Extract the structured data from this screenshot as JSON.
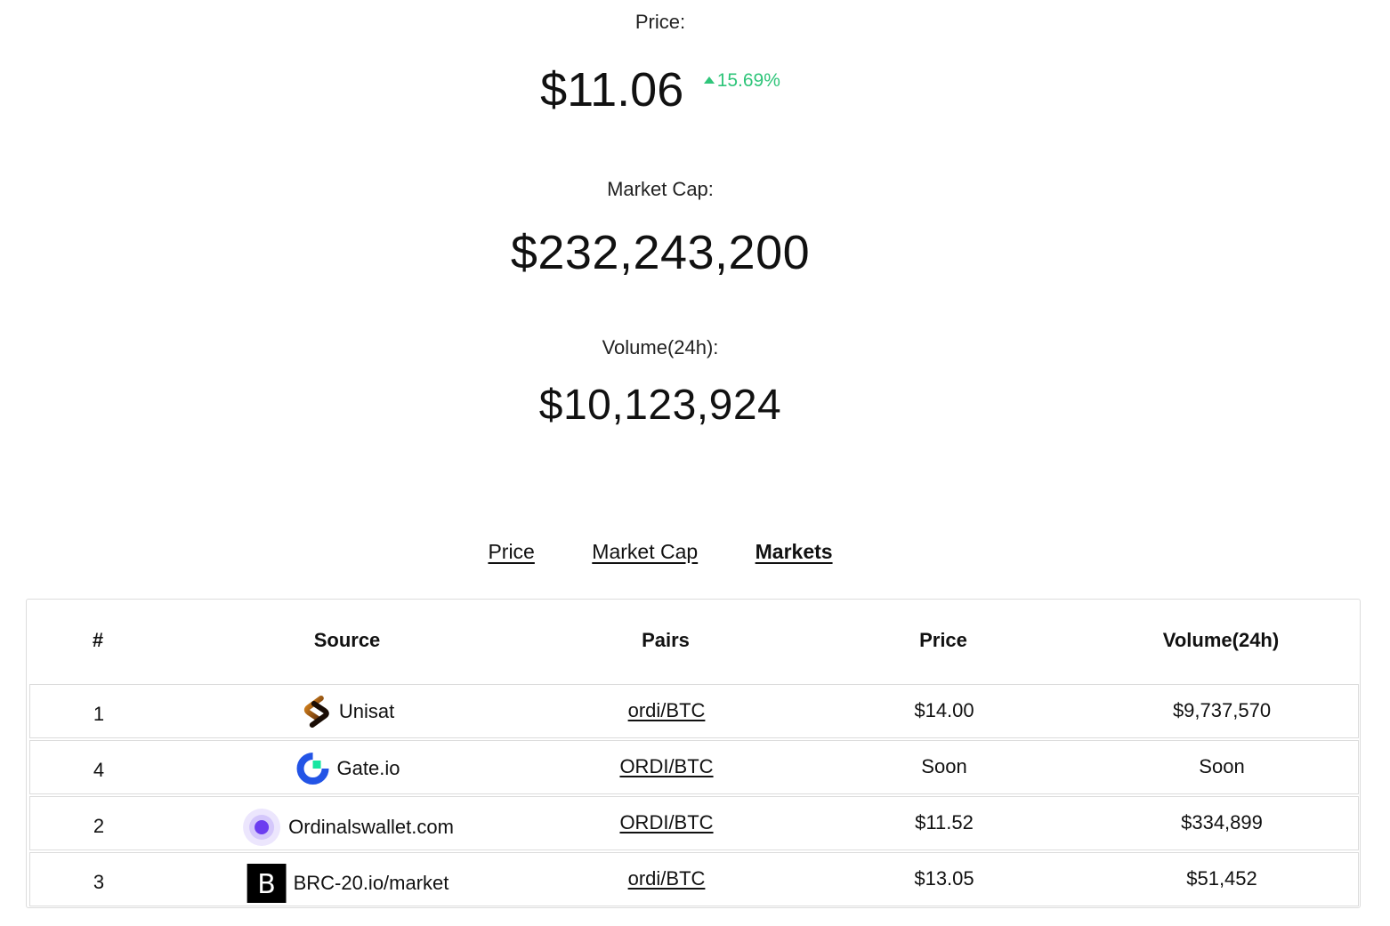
{
  "stats": {
    "price_label": "Price:",
    "price_value": "$11.06",
    "price_change": "15.69%",
    "price_change_color": "#2fc57a",
    "market_cap_label": "Market Cap:",
    "market_cap_value": "$232,243,200",
    "volume_label": "Volume(24h):",
    "volume_value": "$10,123,924"
  },
  "tabs": [
    {
      "label": "Price",
      "active": false
    },
    {
      "label": "Market Cap",
      "active": false
    },
    {
      "label": "Markets",
      "active": true
    }
  ],
  "table": {
    "headers": [
      "#",
      "Source",
      "Pairs",
      "Price",
      "Volume(24h)"
    ],
    "rows": [
      {
        "rank": "1",
        "source": "Unisat",
        "icon": "unisat-logo-icon",
        "pair": "ordi/BTC",
        "price": "$14.00",
        "volume": "$9,737,570"
      },
      {
        "rank": "4",
        "source": "Gate.io",
        "icon": "gateio-logo-icon",
        "pair": "ORDI/BTC",
        "price": "Soon",
        "volume": "Soon"
      },
      {
        "rank": "2",
        "source": "Ordinalswallet.com",
        "icon": "ordinalswallet-logo-icon",
        "pair": "ORDI/BTC",
        "price": "$11.52",
        "volume": "$334,899"
      },
      {
        "rank": "3",
        "source": "BRC-20.io/market",
        "icon": "brc20-logo-icon",
        "pair": "ordi/BTC",
        "price": "$13.05",
        "volume": "$51,452"
      }
    ]
  }
}
